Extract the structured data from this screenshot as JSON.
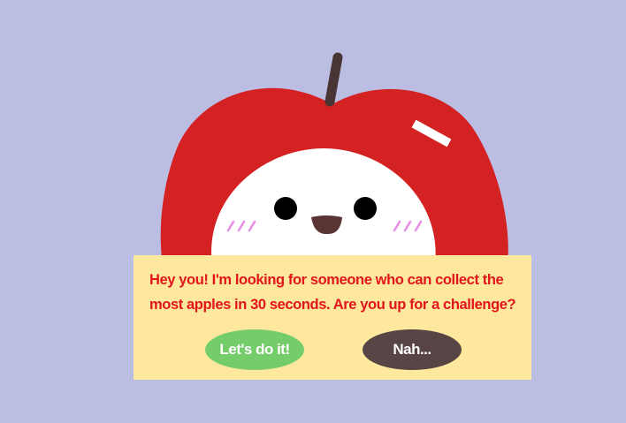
{
  "colors": {
    "background": "#bbbde3",
    "apple_red": "#d42222",
    "stem": "#4a3535",
    "face": "#ffffff",
    "blush": "#e58fe3",
    "dialog_bg": "#fde89d",
    "message_text": "#e1151b",
    "accept_button": "#74cc6a",
    "decline_button": "#574445"
  },
  "character": {
    "name": "apple",
    "expression": "smiling",
    "icons": [
      "apple-body",
      "stem",
      "highlight",
      "face",
      "eyes",
      "mouth",
      "blush-marks"
    ]
  },
  "dialog": {
    "message": "Hey you! I'm looking for someone who can collect the\nmost apples in 30 seconds.  Are you up for a challenge?",
    "accept_label": "Let's do it!",
    "decline_label": "Nah..."
  }
}
